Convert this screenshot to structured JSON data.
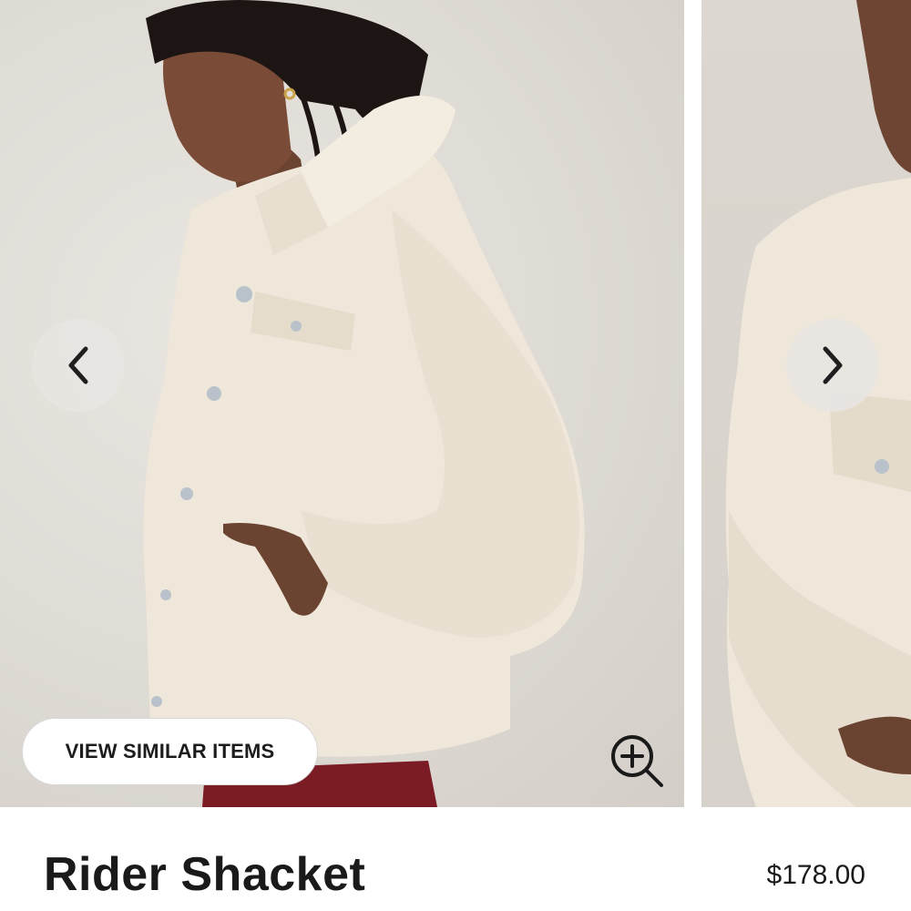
{
  "gallery": {
    "similar_button_label": "VIEW SIMILAR ITEMS",
    "prev_icon": "chevron-left-icon",
    "next_icon": "chevron-right-icon",
    "zoom_icon": "zoom-in-icon"
  },
  "product": {
    "title": "Rider Shacket",
    "price": "$178.00"
  },
  "colors": {
    "background": "#ffffff",
    "photo_backdrop": "#dedad4",
    "jacket": "#efe7da",
    "text": "#1a1a1a",
    "nav_button": "#e8e5e1"
  }
}
